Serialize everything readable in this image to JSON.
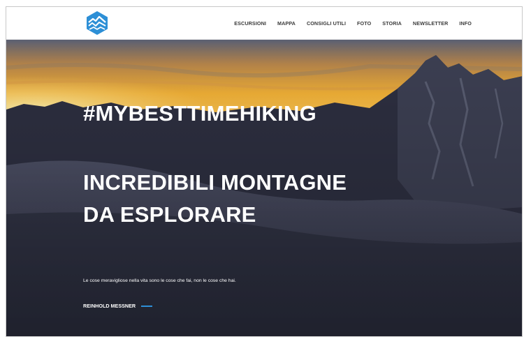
{
  "brand": {
    "logo_icon": "mountain-hexagon-logo-icon",
    "accent": "#2e8fd8"
  },
  "nav": {
    "items": [
      {
        "label": "ESCURSIONI"
      },
      {
        "label": "MAPPA"
      },
      {
        "label": "CONSIGLI UTILI"
      },
      {
        "label": "FOTO"
      },
      {
        "label": "STORIA"
      },
      {
        "label": "NEWSLETTER"
      },
      {
        "label": "INFO"
      }
    ]
  },
  "hero": {
    "hashtag": "#MYBESTTIMEHIKING",
    "headline_line1": "INCREDIBILI MONTAGNE",
    "headline_line2": "DA ESPLORARE",
    "quote": "Le cose meravigliose nella vita sono le cose che fai, non le cose che hai.",
    "author": "REINHOLD MESSNER"
  }
}
